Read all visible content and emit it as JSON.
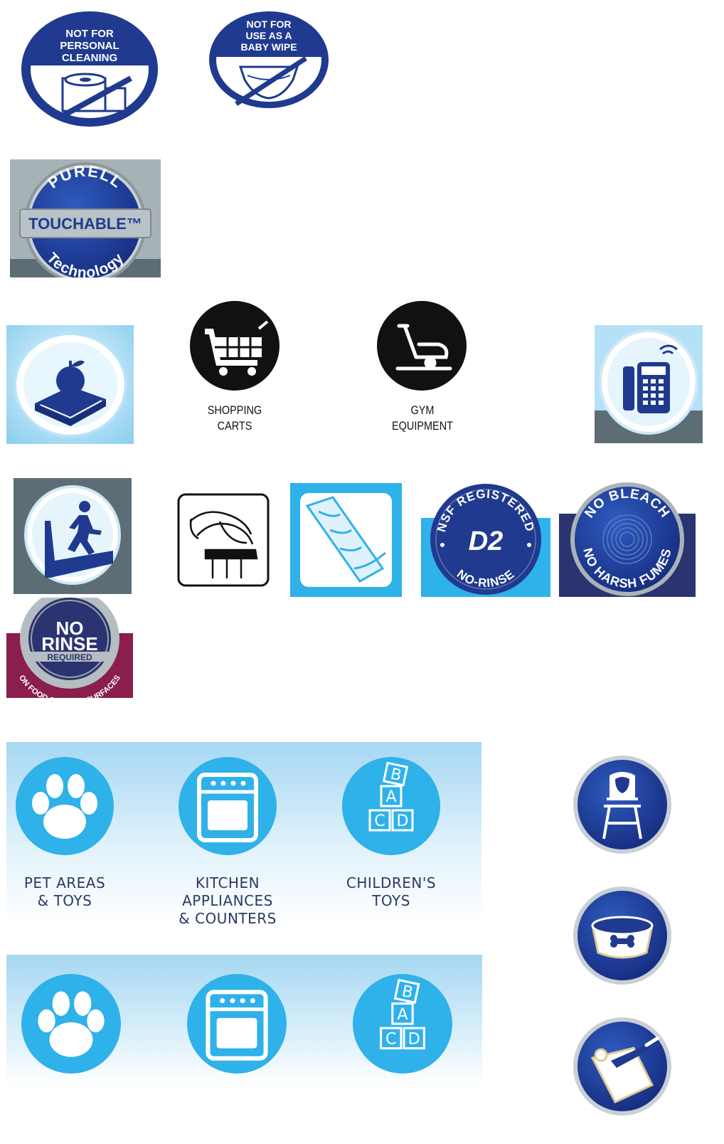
{
  "colors": {
    "navy": "#1f3a8f",
    "light_blue": "#2fb1ea",
    "panel_gradient_top": "#a6d7f2",
    "black": "#111111",
    "maroon": "#8a1e4c",
    "slate": "#5d6d75"
  },
  "badges": {
    "personal_cleaning": {
      "text": "NOT FOR PERSONAL CLEANING",
      "icon": "toilet-paper-icon"
    },
    "baby_wipe": {
      "text": "NOT FOR USE AS A BABY WIPE",
      "icon": "diaper-icon"
    },
    "touchable": {
      "top": "PURELL",
      "middle": "TOUCHABLE™",
      "bottom": "Technology"
    },
    "nsf": {
      "top": "NSF REGISTERED",
      "middle": "D2",
      "bottom": "NO-RINSE"
    },
    "no_bleach": {
      "top": "NO BLEACH",
      "bottom": "NO HARSH FUMES"
    },
    "no_rinse": {
      "line1": "NO",
      "line2": "RINSE",
      "line3": "REQUIRED",
      "arc": "ON FOOD CONTACT SURFACES"
    }
  },
  "black_icons": {
    "carts": {
      "label": "SHOPPING\nCARTS",
      "icon": "shopping-cart-icon"
    },
    "gym": {
      "label": "GYM\nEQUIPMENT",
      "icon": "exercise-bike-icon"
    }
  },
  "blue_panel_top": {
    "items": [
      {
        "label": "PET AREAS\n& TOYS",
        "icon": "paw-icon"
      },
      {
        "label": "KITCHEN APPLIANCES\n& COUNTERS",
        "icon": "stove-icon"
      },
      {
        "label": "CHILDREN'S\nTOYS",
        "icon": "toy-blocks-icon"
      }
    ]
  },
  "blocks": {
    "b": "B",
    "a": "A",
    "c": "C",
    "d": "D"
  },
  "right_column": [
    {
      "icon": "high-chair-icon"
    },
    {
      "icon": "pet-bowl-icon"
    },
    {
      "icon": "cutting-board-icon"
    }
  ]
}
